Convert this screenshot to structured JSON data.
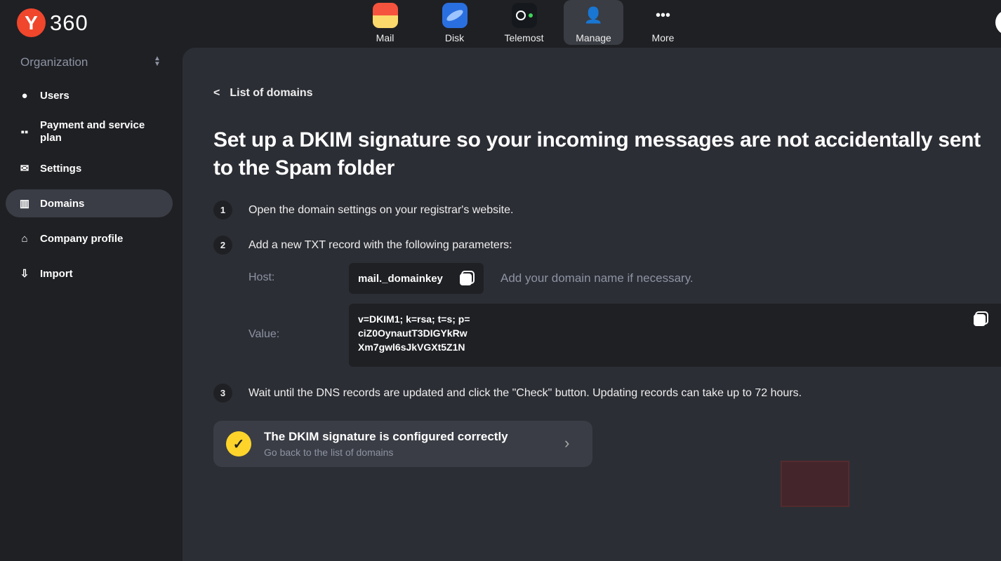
{
  "brand": {
    "logo_letter": "Y",
    "logo_text": "360"
  },
  "apps": [
    {
      "label": "Mail",
      "icon": "mail-icon"
    },
    {
      "label": "Disk",
      "icon": "disk-icon"
    },
    {
      "label": "Telemost",
      "icon": "telemost-icon"
    },
    {
      "label": "Manage",
      "icon": "manage-icon",
      "active": true
    },
    {
      "label": "More",
      "icon": "more-icon"
    }
  ],
  "sidebar": {
    "org_label": "Organization",
    "items": [
      {
        "label": "Users",
        "icon": "user-icon"
      },
      {
        "label": "Payment and service plan",
        "icon": "grid-icon"
      },
      {
        "label": "Settings",
        "icon": "envelope-icon"
      },
      {
        "label": "Domains",
        "icon": "domains-icon",
        "active": true
      },
      {
        "label": "Company profile",
        "icon": "home-icon"
      },
      {
        "label": "Import",
        "icon": "import-icon"
      }
    ]
  },
  "main": {
    "back_label": "List of domains",
    "title": "Set up a DKIM signature so your incoming messages are not accidentally sent to the Spam folder",
    "steps": [
      {
        "num": "1",
        "text": "Open the domain settings on your registrar's website."
      },
      {
        "num": "2",
        "text": "Add a new TXT record with the following parameters:"
      },
      {
        "num": "3",
        "text": "Wait until the DNS records are updated and click the \"Check\" button. Updating records can take up to 72 hours."
      }
    ],
    "host_label": "Host:",
    "host_value": "mail._domainkey",
    "host_hint": "Add your domain name if necessary.",
    "value_label": "Value:",
    "value_lines": [
      "v=DKIM1; k=rsa; t=s; p=",
      "ciZ0OynautT3DIGYkRw",
      "Xm7gwl6sJkVGXt5Z1N"
    ],
    "status_title": "The DKIM signature is configured correctly",
    "status_link": "Go back to the list of domains",
    "accent": "#fed42b"
  }
}
